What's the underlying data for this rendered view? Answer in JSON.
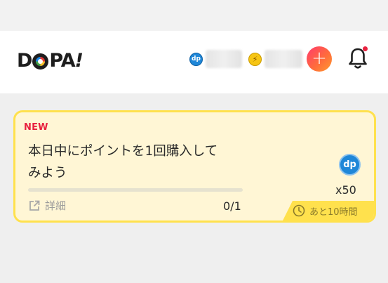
{
  "header": {
    "logo_text": "DOPA!",
    "points_coin_icon": "dp-coin-icon",
    "points_coin_text": "dp",
    "bolt_coin_icon": "bolt-coin-icon",
    "add_icon": "plus-icon",
    "bell_icon": "bell-icon",
    "accent_color": "#ff4d5e"
  },
  "mission": {
    "badge": "NEW",
    "title_line1": "本日中にポイントを1回購入して",
    "title_line2": "みよう",
    "progress_fraction": 0,
    "detail_label": "詳細",
    "count": "0/1",
    "reward_coin_text": "dp",
    "reward_qty": "x50",
    "time_left": "あと10時間",
    "colors": {
      "card_bg": "#fff6d5",
      "card_border": "#ffe14d",
      "badge": "#e8223f"
    }
  }
}
